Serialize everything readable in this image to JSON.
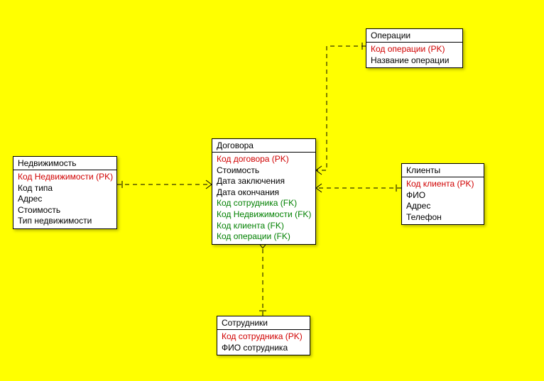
{
  "entities": {
    "operations": {
      "title": "Операции",
      "attrs": [
        {
          "text": "Код операции (PK)",
          "kind": "pk"
        },
        {
          "text": "Название операции",
          "kind": "normal"
        }
      ]
    },
    "contracts": {
      "title": "Договора",
      "attrs": [
        {
          "text": "Код договора (PK)",
          "kind": "pk"
        },
        {
          "text": "Стоимость",
          "kind": "normal"
        },
        {
          "text": "Дата заключения",
          "kind": "normal"
        },
        {
          "text": "Дата окончания",
          "kind": "normal"
        },
        {
          "text": "Код сотрудника (FK)",
          "kind": "fk"
        },
        {
          "text": "Код Недвижимости (FK)",
          "kind": "fk"
        },
        {
          "text": "Код клиента (FK)",
          "kind": "fk"
        },
        {
          "text": "Код операции (FK)",
          "kind": "fk"
        }
      ]
    },
    "realestate": {
      "title": "Недвижимость",
      "attrs": [
        {
          "text": "Код Недвижимости (PK)",
          "kind": "pk"
        },
        {
          "text": "Код типа",
          "kind": "normal"
        },
        {
          "text": "Адрес",
          "kind": "normal"
        },
        {
          "text": "Стоимость",
          "kind": "normal"
        },
        {
          "text": "Тип недвижимости",
          "kind": "normal"
        }
      ]
    },
    "clients": {
      "title": "Клиенты",
      "attrs": [
        {
          "text": "Код клиента (PK)",
          "kind": "pk"
        },
        {
          "text": "ФИО",
          "kind": "normal"
        },
        {
          "text": "Адрес",
          "kind": "normal"
        },
        {
          "text": "Телефон",
          "kind": "normal"
        }
      ]
    },
    "employees": {
      "title": "Сотрудники",
      "attrs": [
        {
          "text": "Код сотрудника (PK)",
          "kind": "pk"
        },
        {
          "text": "ФИО сотрудника",
          "kind": "normal"
        }
      ]
    }
  }
}
